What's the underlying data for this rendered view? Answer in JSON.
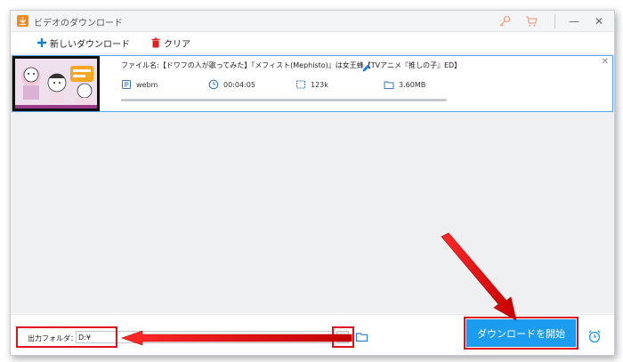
{
  "window": {
    "title": "ビデオのダウンロード",
    "controls": {
      "minimize": "—",
      "close": "✕"
    }
  },
  "toolbar": {
    "new_download_label": "新しいダウンロード",
    "clear_label": "クリア"
  },
  "task": {
    "filename": "ファイル名:【ドワフの人が歌ってみた】『メフィスト(Mephisto)』は女王蜂【TVアニメ『推しの子』ED】",
    "format": "webm",
    "duration": "00:04:05",
    "bitrate": "123k",
    "size": "3.60MB",
    "progress": 0.0,
    "close_glyph": "✕"
  },
  "bottom": {
    "output_label": "出力フォルダ：",
    "output_path": "D:¥",
    "start_label": "ダウンロードを開始"
  },
  "colors": {
    "accent": "#1c9cf0",
    "highlight": "#e0121e",
    "toolbar_plus": "#1a7fd6",
    "clear_red": "#e02020",
    "task_border": "#5aa3e6"
  },
  "icons": [
    "app-icon",
    "key-icon",
    "cart-icon",
    "plus-icon",
    "trash-icon",
    "edit-icon",
    "file-icon",
    "clock-icon",
    "resolution-icon",
    "folder-size-icon",
    "chevron-down-icon",
    "folder-icon",
    "alarm-icon"
  ]
}
